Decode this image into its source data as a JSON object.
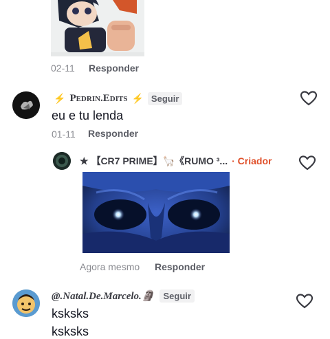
{
  "comment1": {
    "date": "02-11",
    "reply_label": "Responder"
  },
  "comment2": {
    "username": "Pedrin.Edits",
    "follow_label": "Seguir",
    "text": "eu e tu lenda",
    "date": "01-11",
    "reply_label": "Responder"
  },
  "reply1": {
    "username": "★ 【CR7 PRIME】🦙《RUMO ³...",
    "creator_badge": "· Criador",
    "date": "Agora mesmo",
    "reply_label": "Responder"
  },
  "comment3": {
    "username": "@.Natal.De.Marcelo.🗿",
    "follow_label": "Seguir",
    "text": "ksksks",
    "partial_text": "ksksks"
  },
  "colors": {
    "creator": "#e0502a",
    "heart_stroke": "#3a3b42"
  }
}
